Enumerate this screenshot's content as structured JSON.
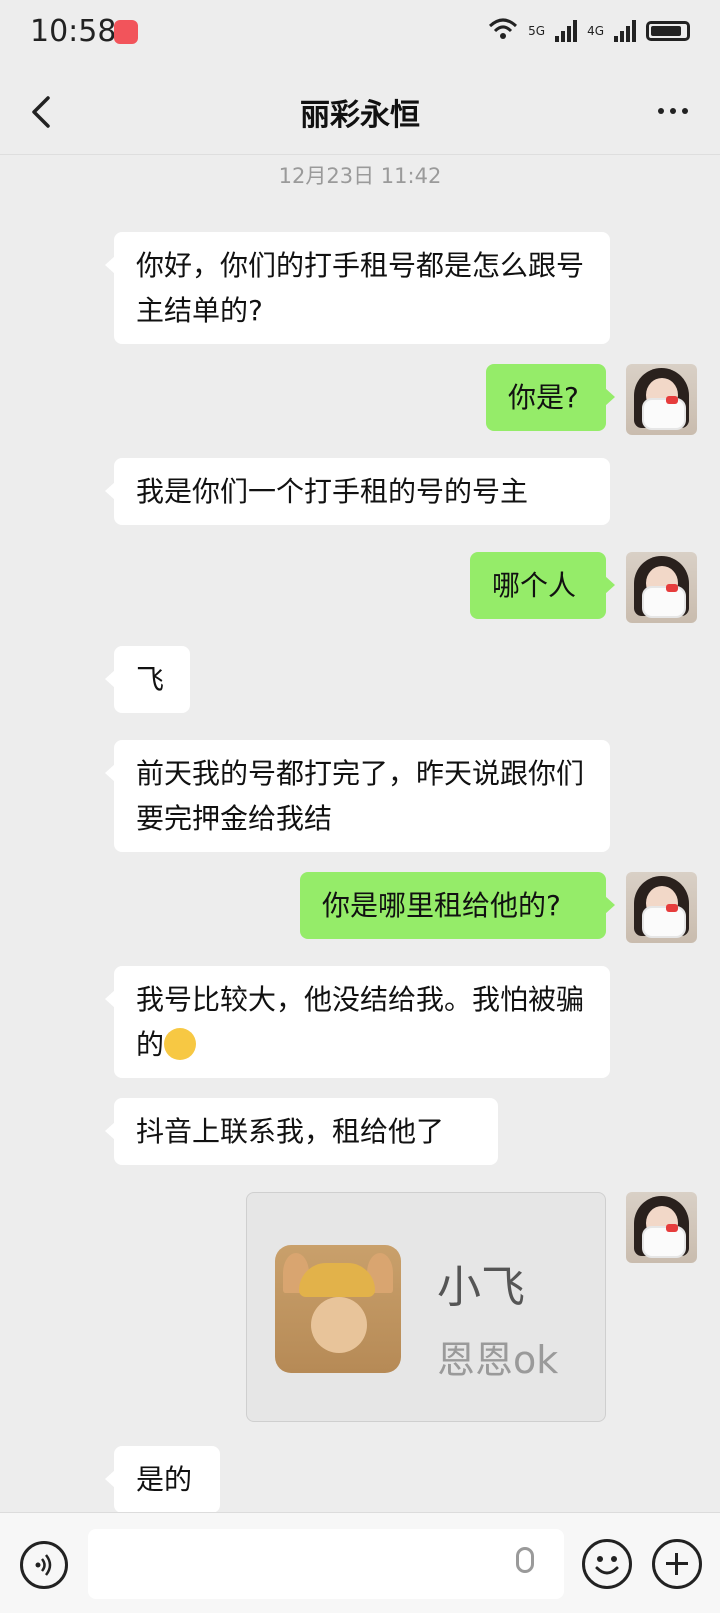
{
  "status_bar": {
    "time": "10:58",
    "net1": "5G",
    "net2": "4G"
  },
  "header": {
    "title": "丽彩永恒",
    "back_icon": "chevron-left-icon",
    "more_icon": "more-icon"
  },
  "chat": {
    "timestamp": "12月23日 11:42",
    "messages": [
      {
        "dir": "in",
        "text": "你好，你们的打手租号都是怎么跟号主结单的?"
      },
      {
        "dir": "out",
        "text": "你是?"
      },
      {
        "dir": "in",
        "text": "我是你们一个打手租的号的号主"
      },
      {
        "dir": "out",
        "text": "哪个人"
      },
      {
        "dir": "in",
        "text": "飞"
      },
      {
        "dir": "in",
        "text": "前天我的号都打完了，昨天说跟你们要完押金给我结"
      },
      {
        "dir": "out",
        "text": "你是哪里租给他的?"
      },
      {
        "dir": "in",
        "text": "我号比较大，他没结给我。我怕被骗的"
      },
      {
        "dir": "in",
        "text": "抖音上联系我，租给他了"
      },
      {
        "dir": "in",
        "text": "是的"
      }
    ],
    "contact_card": {
      "name": "小飞",
      "subtitle": "恩恩ok"
    }
  },
  "input_bar": {
    "placeholder": "",
    "icons": [
      "voice-icon",
      "mic-icon",
      "emoji-icon",
      "plus-icon"
    ]
  },
  "colors": {
    "background": "#ededed",
    "outgoing_bubble": "#95ec69",
    "incoming_bubble": "#ffffff"
  }
}
